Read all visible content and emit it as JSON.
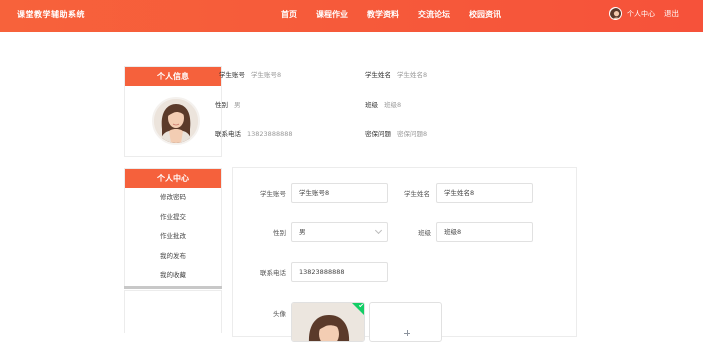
{
  "header": {
    "title": "课堂教学辅助系统",
    "nav": [
      "首页",
      "课程作业",
      "教学资料",
      "交流论坛",
      "校园资讯"
    ],
    "user_center": "个人中心",
    "logout": "退出"
  },
  "profile": {
    "card_title": "个人信息",
    "fields": {
      "account_label": "学生账号",
      "account_value": "学生账号8",
      "name_label": "学生姓名",
      "name_value": "学生姓名8",
      "gender_label": "性别",
      "gender_value": "男",
      "class_label": "班级",
      "class_value": "班级8",
      "phone_label": "联系电话",
      "phone_value": "13823888888",
      "security_label": "密保问题",
      "security_value": "密保问题8"
    }
  },
  "menu": {
    "title": "个人中心",
    "items": [
      "修改密码",
      "作业提交",
      "作业批改",
      "我的发布",
      "我的收藏"
    ]
  },
  "form": {
    "account_label": "学生账号",
    "account_value": "学生账号8",
    "name_label": "学生姓名",
    "name_value": "学生姓名8",
    "gender_label": "性别",
    "gender_value": "男",
    "class_label": "班级",
    "class_value": "班级8",
    "phone_label": "联系电话",
    "phone_value": "13823888888",
    "avatar_label": "头像"
  },
  "colors": {
    "accent": "#f5613c",
    "success": "#13ce66"
  }
}
